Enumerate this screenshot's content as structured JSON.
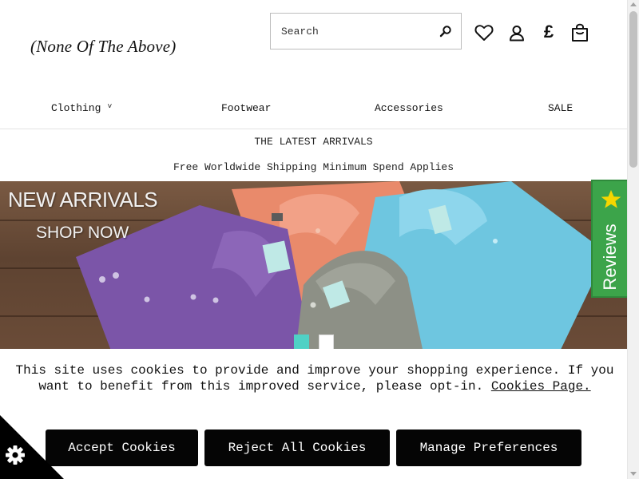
{
  "header": {
    "logo_text": "(None Of The Above)",
    "search_placeholder": "Search",
    "icons": [
      "search-icon",
      "heart-icon",
      "user-icon",
      "pound-currency-icon",
      "shopping-bag-icon"
    ],
    "currency_symbol": "£"
  },
  "nav": {
    "items": [
      {
        "label": "Clothing",
        "has_dropdown": true
      },
      {
        "label": "Footwear"
      },
      {
        "label": "Accessories"
      },
      {
        "label": "SALE"
      }
    ],
    "dropdown_glyph": "˅"
  },
  "promo": {
    "latest": "THE LATEST ARRIVALS",
    "shipping": "Free Worldwide Shipping Minimum Spend Applies"
  },
  "hero": {
    "title": "NEW ARRIVALS",
    "subtitle": "SHOP NOW",
    "slides": 2,
    "active_slide": 1
  },
  "reviews_tab": {
    "label": "Reviews",
    "icon": "star-icon"
  },
  "cookie_banner": {
    "text": "This site uses cookies to provide and improve your shopping experience. If you want to benefit from this improved service, please opt-in.",
    "link_text": "Cookies Page.",
    "buttons": {
      "accept": "Accept Cookies",
      "reject": "Reject All Cookies",
      "manage": "Manage Preferences"
    },
    "settings_icon": "gear-icon"
  },
  "colors": {
    "accent_teal": "#4fd1c5",
    "reviews_green": "#3ca44a",
    "button_black": "#050505"
  }
}
